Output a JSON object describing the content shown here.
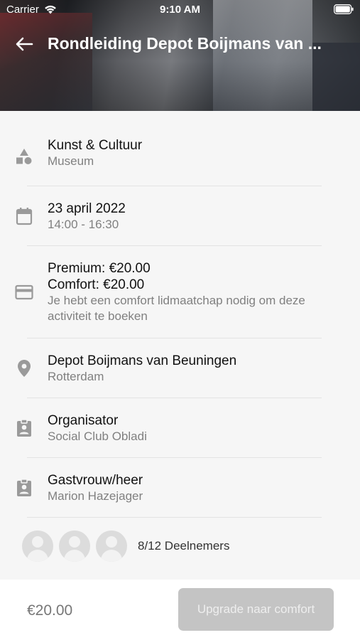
{
  "status_bar": {
    "carrier": "Carrier",
    "time": "9:10 AM"
  },
  "header": {
    "title": "Rondleiding Depot Boijmans van ..."
  },
  "details": [
    {
      "icon": "category-shapes-icon",
      "primary": "Kunst & Cultuur",
      "secondary": [
        "Museum"
      ]
    },
    {
      "icon": "calendar-icon",
      "primary": "23 april 2022",
      "secondary": [
        "14:00 - 16:30"
      ]
    },
    {
      "icon": "credit-card-icon",
      "primary_lines": [
        "Premium: €20.00",
        "Comfort: €20.00"
      ],
      "secondary": [
        "Je hebt een comfort lidmaatchap nodig om deze",
        "activiteit te boeken"
      ]
    },
    {
      "icon": "location-pin-icon",
      "primary": "Depot Boijmans van Beuningen",
      "secondary": [
        "Rotterdam"
      ]
    },
    {
      "icon": "badge-icon",
      "primary": "Organisator",
      "secondary": [
        "Social Club Obladi"
      ]
    },
    {
      "icon": "badge-icon",
      "primary": "Gastvrouw/heer",
      "secondary": [
        "Marion Hazejager"
      ]
    }
  ],
  "participants": {
    "label": "8/12 Deelnemers",
    "avatars": 3
  },
  "footer": {
    "price": "€20.00",
    "button_label": "Upgrade naar comfort"
  }
}
